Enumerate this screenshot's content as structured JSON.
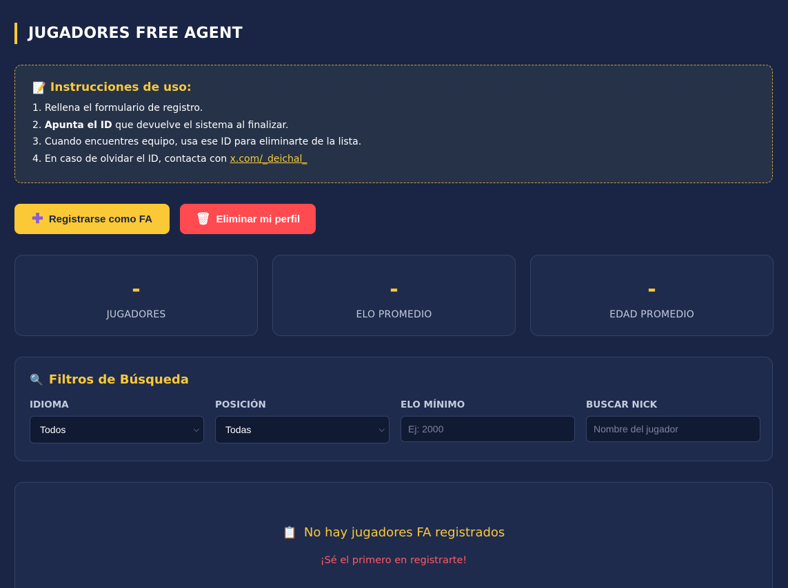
{
  "header": {
    "title": "JUGADORES FREE AGENT"
  },
  "instructions": {
    "icon": "memo-icon",
    "title": "Instrucciones de uso:",
    "steps": [
      {
        "num": "1.",
        "text": "Rellena el formulario de registro."
      },
      {
        "num": "2.",
        "bold": "Apunta el ID",
        "text": " que devuelve el sistema al finalizar."
      },
      {
        "num": "3.",
        "text": "Cuando encuentres equipo, usa ese ID para eliminarte de la lista."
      },
      {
        "num": "4.",
        "text": "En caso de olvidar el ID, contacta con ",
        "link": "x.com/_deichal_"
      }
    ]
  },
  "actions": {
    "register_label": "Registrarse como FA",
    "register_icon": "plus-icon",
    "delete_label": "Eliminar mi perfil",
    "delete_icon": "trash-icon"
  },
  "stats": [
    {
      "value": "-",
      "label": "JUGADORES"
    },
    {
      "value": "-",
      "label": "ELO PROMEDIO"
    },
    {
      "value": "-",
      "label": "EDAD PROMEDIO"
    }
  ],
  "filters": {
    "icon": "magnifier-icon",
    "title": "Filtros de Búsqueda",
    "idioma": {
      "label": "IDIOMA",
      "value": "Todos"
    },
    "posicion": {
      "label": "POSICIÓN",
      "value": "Todas"
    },
    "elo": {
      "label": "ELO MÍNIMO",
      "placeholder": "Ej: 2000"
    },
    "nick": {
      "label": "BUSCAR NICK",
      "placeholder": "Nombre del jugador"
    }
  },
  "empty": {
    "icon": "clipboard-icon",
    "title": "No hay jugadores FA registrados",
    "subtitle": "¡Sé el primero en registrarte!"
  },
  "colors": {
    "background": "#1a2545",
    "accent": "#f9c93a",
    "danger": "#ff4a4f",
    "panel": "#1f2b4c"
  }
}
